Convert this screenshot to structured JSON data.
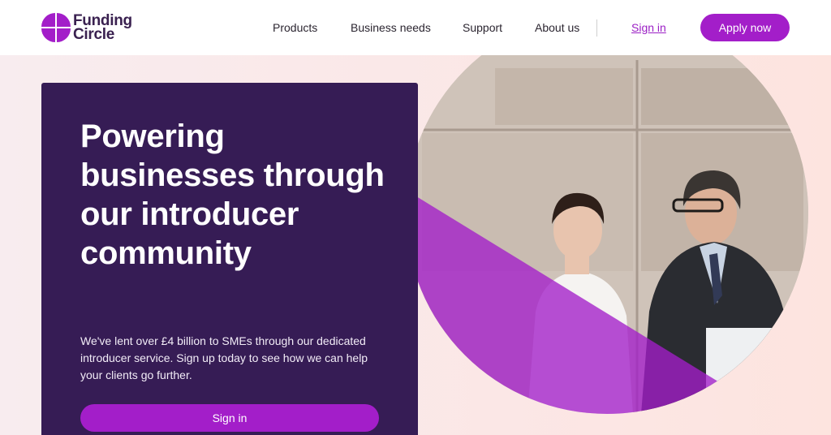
{
  "brand": {
    "name_line1": "Funding",
    "name_line2": "Circle",
    "color": "#a31ec9"
  },
  "nav": {
    "items": [
      "Products",
      "Business needs",
      "Support",
      "About us"
    ],
    "sign_in": "Sign in",
    "apply": "Apply now"
  },
  "hero": {
    "headline": "Powering businesses through our introducer community",
    "subtext": "We've lent over £4 billion to SMEs through our dedicated introducer service. Sign up today to see how we can help your clients go further.",
    "cta": "Sign in"
  },
  "colors": {
    "panel": "#361c55",
    "accent": "#a31ec9",
    "hero_bg": "#fbe7e6"
  }
}
